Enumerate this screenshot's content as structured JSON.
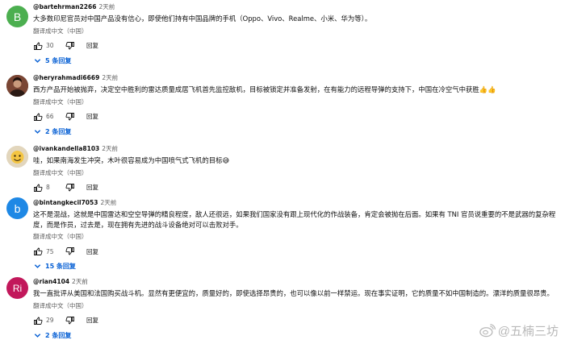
{
  "comments": [
    {
      "avatar_letter": "B",
      "avatar_color": "#4caf50",
      "handle": "@bartehrman2266",
      "time": "2天前",
      "text": "大多数印尼官员对中国产品没有信心，即使他们持有中国品牌的手机（Oppo、Vivo、Realme、小米、华为等）。",
      "translate": "翻译成中文（中国）",
      "likes": "30",
      "reply_label": "回复",
      "replies_label": "5 条回复"
    },
    {
      "avatar_letter": "",
      "avatar_color": "#6b3b2a",
      "handle": "@heryrahmadi6669",
      "time": "2天前",
      "text": "西方产品开始被抛弃，决定空中胜利的雷达质量成居飞机首先监控敌机，目标被锁定并准备发射，在有能力的远程导弹的支持下，中国在冷空气中获胜👍👍",
      "translate": "翻译成中文（中国）",
      "likes": "66",
      "reply_label": "回复",
      "replies_label": "2 条回复"
    },
    {
      "avatar_letter": "",
      "avatar_color": "#d9c9a8",
      "handle": "@ivankandella8103",
      "time": "2天前",
      "text": "哇，如果南海发生冲突，木叶很容易成为中国喷气式飞机的目标😅",
      "translate": "翻译成中文（中国）",
      "likes": "8",
      "reply_label": "回复",
      "replies_label": ""
    },
    {
      "avatar_letter": "b",
      "avatar_color": "#1e88e5",
      "handle": "@bintangkecil7053",
      "time": "2天前",
      "text": "这不是混战，这就是中国雷达和空空导弹的精良程度，敌人还很远，如果我们国家没有跟上现代化的作战装备，肯定会被抛在后面。如果有 TNI 官员说重要的不是武器的复杂程度，而是作员，过去是，现在拥有先进的战斗设备绝对可以击败对手。",
      "translate": "翻译成中文（中国）",
      "likes": "75",
      "reply_label": "回复",
      "replies_label": "15 条回复"
    },
    {
      "avatar_letter": "Ri",
      "avatar_color": "#c2185b",
      "handle": "@rian4104",
      "time": "2天前",
      "text": "我一直批评从美国和法国购买战斗机。显然有更便宜的，质量好的，即使选择昂贵的，也可以像以前一样禁运。现在事实证明，它的质量不如中国制造的。漂洋的质量很昂贵。",
      "translate": "翻译成中文（中国）",
      "likes": "29",
      "reply_label": "回复",
      "replies_label": "2 条回复"
    }
  ],
  "watermark": {
    "text": "@五楠三坊",
    "icon": "weibo-logo-icon"
  }
}
